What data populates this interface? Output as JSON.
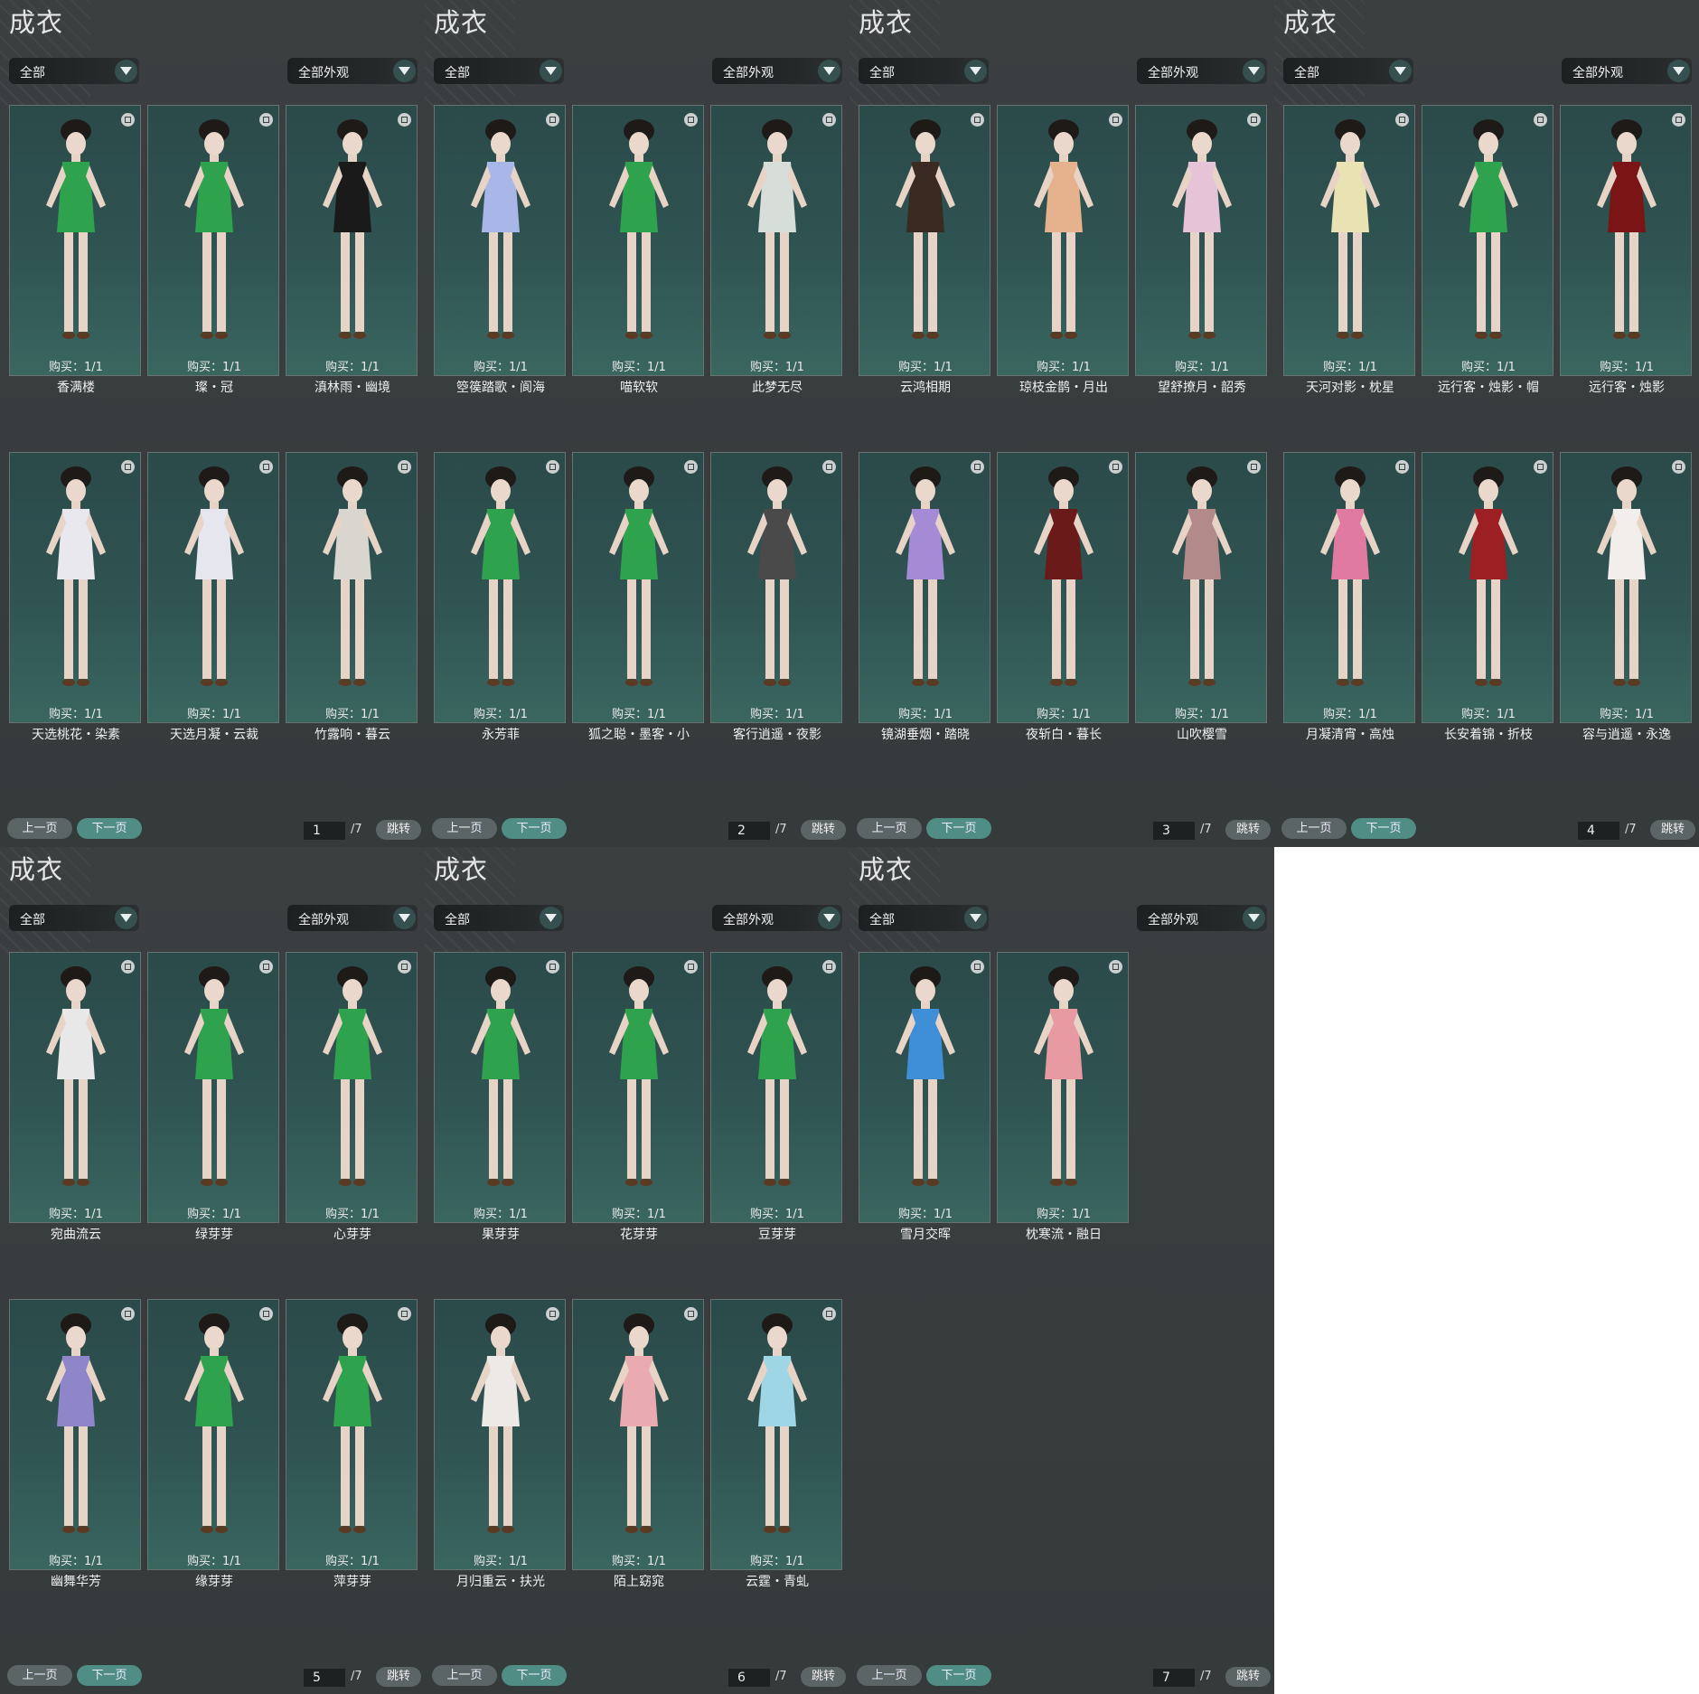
{
  "panel_title": "成衣",
  "filter_category": "全部",
  "filter_appearance": "全部外观",
  "prev_label": "上一页",
  "next_label": "下一页",
  "jump_label": "跳转",
  "total_label": "/7",
  "panels": [
    {
      "page": "1",
      "items": [
        {
          "buy": "购买：1/1",
          "name": "香满楼",
          "outfit_color": "#2fa24e"
        },
        {
          "buy": "购买：1/1",
          "name": "璨・冠",
          "outfit_color": "#2fa24e"
        },
        {
          "buy": "购买：1/1",
          "name": "滇林雨・幽境",
          "outfit_color": "#1a1a1a"
        },
        {
          "buy": "购买：1/1",
          "name": "天选桃花・染素",
          "outfit_color": "#e8e8ee"
        },
        {
          "buy": "购买：1/1",
          "name": "天选月凝・云裁",
          "outfit_color": "#e6e6ee"
        },
        {
          "buy": "购买：1/1",
          "name": "竹露响・暮云",
          "outfit_color": "#d8d6cf"
        }
      ]
    },
    {
      "page": "2",
      "items": [
        {
          "buy": "购买：1/1",
          "name": "箜篌踏歌・阆海",
          "outfit_color": "#a9b7e8"
        },
        {
          "buy": "购买：1/1",
          "name": "喵软软",
          "outfit_color": "#2fa24e"
        },
        {
          "buy": "购买：1/1",
          "name": "此梦无尽",
          "outfit_color": "#d7ddd8"
        },
        {
          "buy": "购买：1/1",
          "name": "永芳菲",
          "outfit_color": "#2fa24e"
        },
        {
          "buy": "购买：1/1",
          "name": "狐之聪・墨客・小",
          "outfit_color": "#2fa24e"
        },
        {
          "buy": "购买：1/1",
          "name": "客行逍遥・夜影",
          "outfit_color": "#4b4a4a"
        }
      ]
    },
    {
      "page": "3",
      "items": [
        {
          "buy": "购买：1/1",
          "name": "云鸿相期",
          "outfit_color": "#3b2a22"
        },
        {
          "buy": "购买：1/1",
          "name": "琼枝金鹊・月出",
          "outfit_color": "#e6b28e"
        },
        {
          "buy": "购买：1/1",
          "name": "望舒撩月・韶秀",
          "outfit_color": "#e6c3d6"
        },
        {
          "buy": "购买：1/1",
          "name": "镜湖垂烟・踏晓",
          "outfit_color": "#a58ad6"
        },
        {
          "buy": "购买：1/1",
          "name": "夜斩白・暮长",
          "outfit_color": "#6b1a1a"
        },
        {
          "buy": "购买：1/1",
          "name": "山吹樱雪",
          "outfit_color": "#b28a8a"
        }
      ]
    },
    {
      "page": "4",
      "items": [
        {
          "buy": "购买：1/1",
          "name": "天河对影・枕星",
          "outfit_color": "#e9e2b2"
        },
        {
          "buy": "购买：1/1",
          "name": "远行客・烛影・帽",
          "outfit_color": "#2fa24e"
        },
        {
          "buy": "购买：1/1",
          "name": "远行客・烛影",
          "outfit_color": "#7b1414"
        },
        {
          "buy": "购买：1/1",
          "name": "月凝清宵・高烛",
          "outfit_color": "#e07aa0"
        },
        {
          "buy": "购买：1/1",
          "name": "长安着锦・折枝",
          "outfit_color": "#9c1f24"
        },
        {
          "buy": "购买：1/1",
          "name": "容与逍遥・永逸",
          "outfit_color": "#f2eeec"
        }
      ]
    },
    {
      "page": "5",
      "items": [
        {
          "buy": "购买：1/1",
          "name": "宛曲流云",
          "outfit_color": "#e8e8e8"
        },
        {
          "buy": "购买：1/1",
          "name": "绿芽芽",
          "outfit_color": "#2fa24e"
        },
        {
          "buy": "购买：1/1",
          "name": "心芽芽",
          "outfit_color": "#2fa24e"
        },
        {
          "buy": "购买：1/1",
          "name": "幽舞华芳",
          "outfit_color": "#8e86c8"
        },
        {
          "buy": "购买：1/1",
          "name": "缘芽芽",
          "outfit_color": "#2fa24e"
        },
        {
          "buy": "购买：1/1",
          "name": "萍芽芽",
          "outfit_color": "#2fa24e"
        }
      ]
    },
    {
      "page": "6",
      "items": [
        {
          "buy": "购买：1/1",
          "name": "果芽芽",
          "outfit_color": "#2fa24e"
        },
        {
          "buy": "购买：1/1",
          "name": "花芽芽",
          "outfit_color": "#2fa24e"
        },
        {
          "buy": "购买：1/1",
          "name": "豆芽芽",
          "outfit_color": "#2fa24e"
        },
        {
          "buy": "购买：1/1",
          "name": "月归重云・扶光",
          "outfit_color": "#ece9e6"
        },
        {
          "buy": "购买：1/1",
          "name": "陌上窈窕",
          "outfit_color": "#e9aab0"
        },
        {
          "buy": "购买：1/1",
          "name": "云霆・青虬",
          "outfit_color": "#9fd6e6"
        }
      ]
    },
    {
      "page": "7",
      "items": [
        {
          "buy": "购买：1/1",
          "name": "雪月交晖",
          "outfit_color": "#3f8fd8"
        },
        {
          "buy": "购买：1/1",
          "name": "枕寒流・融日",
          "outfit_color": "#e79aa2"
        }
      ]
    }
  ]
}
